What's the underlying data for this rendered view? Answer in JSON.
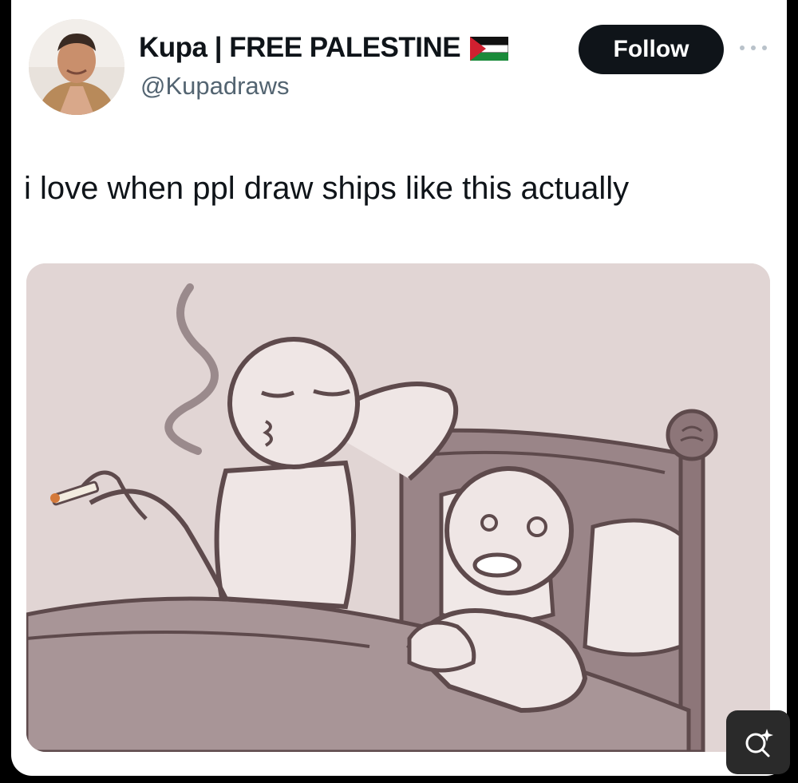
{
  "tweet": {
    "display_name": "Kupa | FREE PALESTINE",
    "handle": "@Kupadraws",
    "follow_label": "Follow",
    "text": "i love when ppl draw ships like this actually",
    "flag_icon": "palestine-flag-icon",
    "more_icon": "more-options-icon"
  },
  "media": {
    "type": "illustration",
    "colors": {
      "background": "#e1d5d4",
      "line": "#5e4a4c",
      "bed": "#9a8588",
      "sheet": "#a89597"
    }
  },
  "overlay": {
    "visual_search_icon": "visual-search-icon"
  }
}
